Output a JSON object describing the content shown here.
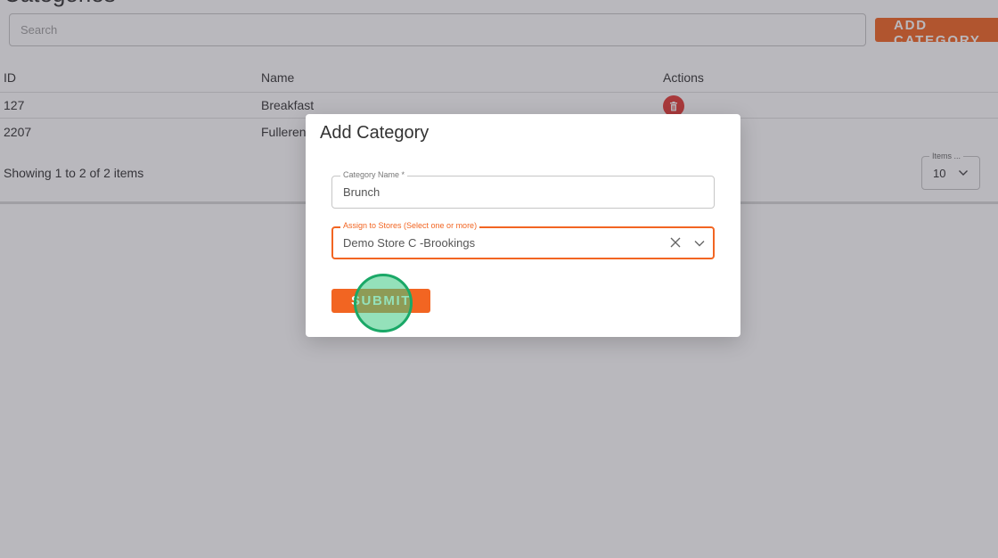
{
  "page": {
    "title": "Categories",
    "search_placeholder": "Search",
    "add_button_label": "ADD CATEGORY"
  },
  "table": {
    "columns": [
      "ID",
      "Name",
      "Actions"
    ],
    "rows": [
      {
        "id": "127",
        "name": "Breakfast"
      },
      {
        "id": "2207",
        "name": "Fullerene"
      }
    ],
    "showing_text": "Showing 1 to 2 of 2 items",
    "items_per_page_label": "Items ...",
    "items_per_page_value": "10"
  },
  "modal": {
    "title": "Add Category",
    "category_name_label": "Category Name *",
    "category_name_value": "Brunch",
    "stores_label": "Assign to Stores (Select one or more)",
    "stores_value": "Demo Store C -Brookings",
    "submit_label": "SUBMIT"
  },
  "icons": {
    "delete": "trash-icon",
    "clear": "close-icon",
    "dropdown": "chevron-down-icon"
  },
  "colors": {
    "accent": "#f26522",
    "danger": "#e53935",
    "click_marker": "#1aa867"
  }
}
